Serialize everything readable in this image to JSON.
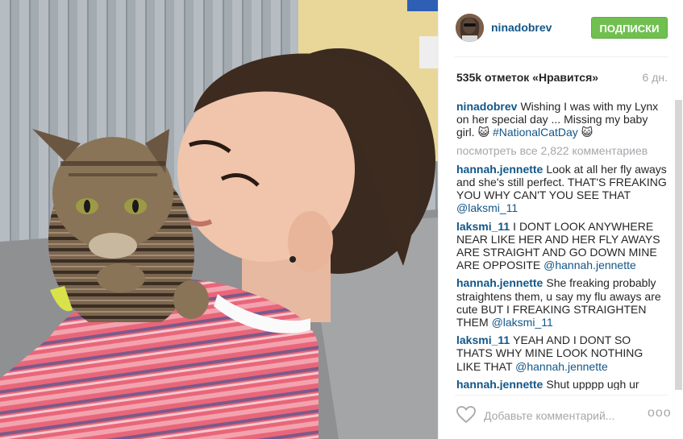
{
  "post": {
    "image_alt": "Girl holding a tabby cat on her shoulder",
    "icons": [
      "heart-icon",
      "more-dots-icon"
    ]
  },
  "header": {
    "username": "ninadobrev",
    "follow_label": "ПОДПИСКИ"
  },
  "stats": {
    "likes": "535k отметок «Нравится»",
    "time_ago": "6 дн."
  },
  "caption": {
    "author": "ninadobrev",
    "text": "Wishing I was with my Lynx on her special day ... Missing my baby girl. 😺 ",
    "hashtag": "#NationalCatDay",
    "emoji_end": " 😺"
  },
  "view_all": "посмотреть все 2,822 комментариев",
  "comments": [
    {
      "author": "hannah.jennette",
      "text": "Look at all her fly aways and she's still perfect. THAT'S FREAKING YOU WHY CAN'T YOU SEE THAT ",
      "mention": "@laksmi_11"
    },
    {
      "author": "laksmi_11",
      "text": "I DONT LOOK ANYWHERE NEAR LIKE HER AND HER FLY AWAYS ARE STRAIGHT AND GO DOWN MINE ARE OPPOSITE ",
      "mention": "@hannah.jennette"
    },
    {
      "author": "hannah.jennette",
      "text": "She freaking probably straightens them, u say my flu aways are cute BUT I FREAKING STRAIGHTEN THEM ",
      "mention": "@laksmi_11"
    },
    {
      "author": "laksmi_11",
      "text": "YEAH AND I DONT SO THATS WHY MINE LOOK NOTHING LIKE THAT ",
      "mention": "@hannah.jennette"
    },
    {
      "author": "hannah.jennette",
      "text": "Shut upppp ugh ur",
      "mention": ""
    }
  ],
  "footer": {
    "comment_placeholder": "Добавьте комментарий...",
    "more_label": "ooo"
  },
  "colors": {
    "link": "#125688",
    "follow_bg": "#70c050",
    "muted": "#a5a7aa"
  }
}
